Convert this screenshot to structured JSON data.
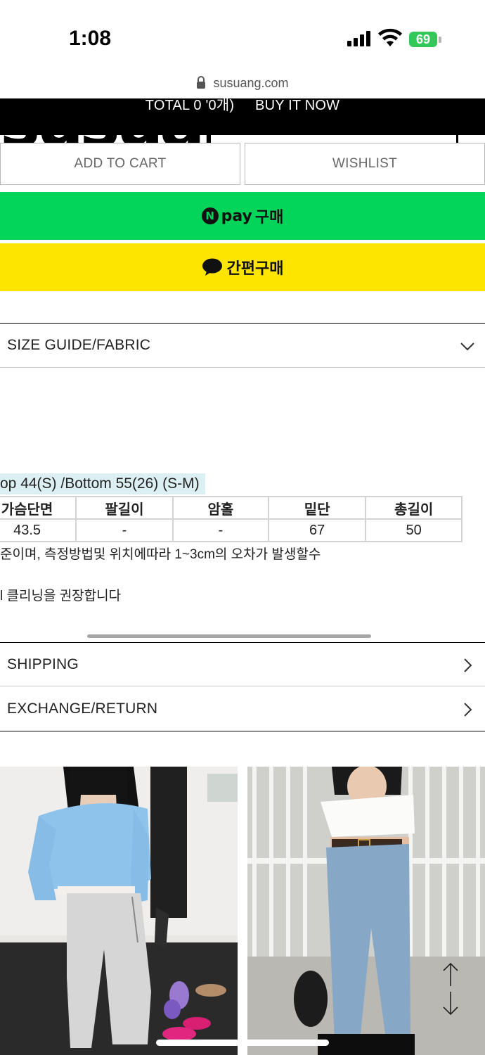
{
  "status_bar": {
    "time": "1:08",
    "battery": "69"
  },
  "browser": {
    "url": "susuang.com"
  },
  "header": {
    "total": "TOTAL 0 '0개)",
    "buy_now": "BUY IT NOW"
  },
  "actions": {
    "add_to_cart": "ADD TO CART",
    "wishlist": "WISHLIST",
    "npay_brand": "pay",
    "npay_label": "구매",
    "kakao_label": "간편구매"
  },
  "accordions": {
    "size_guide": "SIZE GUIDE/FABRIC",
    "shipping": "SHIPPING",
    "exchange": "EXCHANGE/RETURN"
  },
  "size_guide": {
    "heading": "op 44(S) /Bottom 55(26) (S-M)",
    "columns": [
      "가슴단면",
      "팔길이",
      "암홀",
      "밑단",
      "총길이"
    ],
    "values": [
      "43.5",
      "-",
      "-",
      "67",
      "50"
    ],
    "note_1": "준이며, 측정방법및 위치에따라 1~3cm의 오차가 발생할수",
    "note_2": "l 클리닝을 권장합니다"
  },
  "colors": {
    "npay_green": "#03d45a",
    "kakao_yellow": "#fee500",
    "header_black": "#000000",
    "size_highlight": "#dcf0f3"
  }
}
